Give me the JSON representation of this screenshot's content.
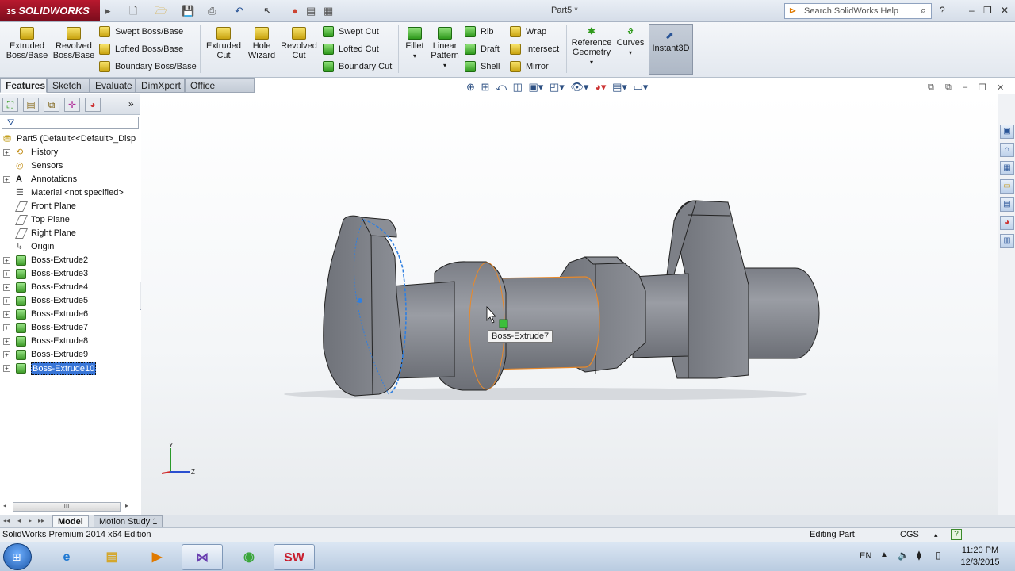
{
  "app": {
    "logo": "SOLIDWORKS",
    "logo_prefix": "3S",
    "document_title": "Part5 *",
    "search_placeholder": "Search SolidWorks Help"
  },
  "command_manager": {
    "big_buttons": [
      "Extruded Boss/Base",
      "Revolved Boss/Base",
      "Extruded Cut",
      "Hole Wizard",
      "Revolved Cut",
      "Fillet",
      "Linear Pattern",
      "Reference Geometry",
      "Curves",
      "Instant3D"
    ],
    "boss_small": [
      "Swept Boss/Base",
      "Lofted Boss/Base",
      "Boundary Boss/Base"
    ],
    "cut_small": [
      "Swept Cut",
      "Lofted Cut",
      "Boundary Cut"
    ],
    "feature_small": [
      "Rib",
      "Draft",
      "Shell",
      "Wrap",
      "Intersect",
      "Mirror"
    ]
  },
  "tabs": [
    "Features",
    "Sketch",
    "Evaluate",
    "DimXpert",
    "Office Products"
  ],
  "active_tab": "Features",
  "tree": {
    "root": "Part5  (Default<<Default>_Disp",
    "items": [
      "History",
      "Sensors",
      "Annotations",
      "Material <not specified>",
      "Front Plane",
      "Top Plane",
      "Right Plane",
      "Origin",
      "Boss-Extrude2",
      "Boss-Extrude3",
      "Boss-Extrude4",
      "Boss-Extrude5",
      "Boss-Extrude6",
      "Boss-Extrude7",
      "Boss-Extrude8",
      "Boss-Extrude9",
      "Boss-Extrude10"
    ],
    "selected": "Boss-Extrude10"
  },
  "viewport": {
    "tooltip": "Boss-Extrude7",
    "triad": {
      "y": "Y",
      "z": "Z"
    }
  },
  "bottom_tabs": [
    "Model",
    "Motion Study 1"
  ],
  "status": {
    "edition": "SolidWorks Premium 2014 x64 Edition",
    "mode": "Editing Part",
    "units": "CGS"
  },
  "taskbar": {
    "language": "EN",
    "time": "11:20 PM",
    "date": "12/3/2015",
    "apps": [
      "internet-explorer",
      "file-explorer",
      "media-player",
      "visual-studio",
      "app-green",
      "solidworks"
    ]
  },
  "colors": {
    "accent": "#3875d7",
    "logo_red": "#b8192e",
    "highlight_orange": "#e8892a",
    "selection_blue": "#2f7fe0",
    "model_gray": "#868991"
  }
}
